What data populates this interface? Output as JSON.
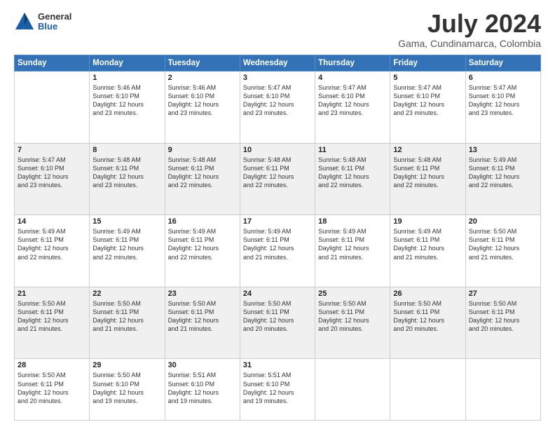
{
  "logo": {
    "general": "General",
    "blue": "Blue"
  },
  "title": {
    "month_year": "July 2024",
    "location": "Gama, Cundinamarca, Colombia"
  },
  "headers": [
    "Sunday",
    "Monday",
    "Tuesday",
    "Wednesday",
    "Thursday",
    "Friday",
    "Saturday"
  ],
  "weeks": [
    [
      {
        "day": "",
        "info": ""
      },
      {
        "day": "1",
        "info": "Sunrise: 5:46 AM\nSunset: 6:10 PM\nDaylight: 12 hours\nand 23 minutes."
      },
      {
        "day": "2",
        "info": "Sunrise: 5:46 AM\nSunset: 6:10 PM\nDaylight: 12 hours\nand 23 minutes."
      },
      {
        "day": "3",
        "info": "Sunrise: 5:47 AM\nSunset: 6:10 PM\nDaylight: 12 hours\nand 23 minutes."
      },
      {
        "day": "4",
        "info": "Sunrise: 5:47 AM\nSunset: 6:10 PM\nDaylight: 12 hours\nand 23 minutes."
      },
      {
        "day": "5",
        "info": "Sunrise: 5:47 AM\nSunset: 6:10 PM\nDaylight: 12 hours\nand 23 minutes."
      },
      {
        "day": "6",
        "info": "Sunrise: 5:47 AM\nSunset: 6:10 PM\nDaylight: 12 hours\nand 23 minutes."
      }
    ],
    [
      {
        "day": "7",
        "info": "Sunrise: 5:47 AM\nSunset: 6:10 PM\nDaylight: 12 hours\nand 23 minutes."
      },
      {
        "day": "8",
        "info": "Sunrise: 5:48 AM\nSunset: 6:11 PM\nDaylight: 12 hours\nand 23 minutes."
      },
      {
        "day": "9",
        "info": "Sunrise: 5:48 AM\nSunset: 6:11 PM\nDaylight: 12 hours\nand 22 minutes."
      },
      {
        "day": "10",
        "info": "Sunrise: 5:48 AM\nSunset: 6:11 PM\nDaylight: 12 hours\nand 22 minutes."
      },
      {
        "day": "11",
        "info": "Sunrise: 5:48 AM\nSunset: 6:11 PM\nDaylight: 12 hours\nand 22 minutes."
      },
      {
        "day": "12",
        "info": "Sunrise: 5:48 AM\nSunset: 6:11 PM\nDaylight: 12 hours\nand 22 minutes."
      },
      {
        "day": "13",
        "info": "Sunrise: 5:49 AM\nSunset: 6:11 PM\nDaylight: 12 hours\nand 22 minutes."
      }
    ],
    [
      {
        "day": "14",
        "info": "Sunrise: 5:49 AM\nSunset: 6:11 PM\nDaylight: 12 hours\nand 22 minutes."
      },
      {
        "day": "15",
        "info": "Sunrise: 5:49 AM\nSunset: 6:11 PM\nDaylight: 12 hours\nand 22 minutes."
      },
      {
        "day": "16",
        "info": "Sunrise: 5:49 AM\nSunset: 6:11 PM\nDaylight: 12 hours\nand 22 minutes."
      },
      {
        "day": "17",
        "info": "Sunrise: 5:49 AM\nSunset: 6:11 PM\nDaylight: 12 hours\nand 21 minutes."
      },
      {
        "day": "18",
        "info": "Sunrise: 5:49 AM\nSunset: 6:11 PM\nDaylight: 12 hours\nand 21 minutes."
      },
      {
        "day": "19",
        "info": "Sunrise: 5:49 AM\nSunset: 6:11 PM\nDaylight: 12 hours\nand 21 minutes."
      },
      {
        "day": "20",
        "info": "Sunrise: 5:50 AM\nSunset: 6:11 PM\nDaylight: 12 hours\nand 21 minutes."
      }
    ],
    [
      {
        "day": "21",
        "info": "Sunrise: 5:50 AM\nSunset: 6:11 PM\nDaylight: 12 hours\nand 21 minutes."
      },
      {
        "day": "22",
        "info": "Sunrise: 5:50 AM\nSunset: 6:11 PM\nDaylight: 12 hours\nand 21 minutes."
      },
      {
        "day": "23",
        "info": "Sunrise: 5:50 AM\nSunset: 6:11 PM\nDaylight: 12 hours\nand 21 minutes."
      },
      {
        "day": "24",
        "info": "Sunrise: 5:50 AM\nSunset: 6:11 PM\nDaylight: 12 hours\nand 20 minutes."
      },
      {
        "day": "25",
        "info": "Sunrise: 5:50 AM\nSunset: 6:11 PM\nDaylight: 12 hours\nand 20 minutes."
      },
      {
        "day": "26",
        "info": "Sunrise: 5:50 AM\nSunset: 6:11 PM\nDaylight: 12 hours\nand 20 minutes."
      },
      {
        "day": "27",
        "info": "Sunrise: 5:50 AM\nSunset: 6:11 PM\nDaylight: 12 hours\nand 20 minutes."
      }
    ],
    [
      {
        "day": "28",
        "info": "Sunrise: 5:50 AM\nSunset: 6:11 PM\nDaylight: 12 hours\nand 20 minutes."
      },
      {
        "day": "29",
        "info": "Sunrise: 5:50 AM\nSunset: 6:10 PM\nDaylight: 12 hours\nand 19 minutes."
      },
      {
        "day": "30",
        "info": "Sunrise: 5:51 AM\nSunset: 6:10 PM\nDaylight: 12 hours\nand 19 minutes."
      },
      {
        "day": "31",
        "info": "Sunrise: 5:51 AM\nSunset: 6:10 PM\nDaylight: 12 hours\nand 19 minutes."
      },
      {
        "day": "",
        "info": ""
      },
      {
        "day": "",
        "info": ""
      },
      {
        "day": "",
        "info": ""
      }
    ]
  ]
}
